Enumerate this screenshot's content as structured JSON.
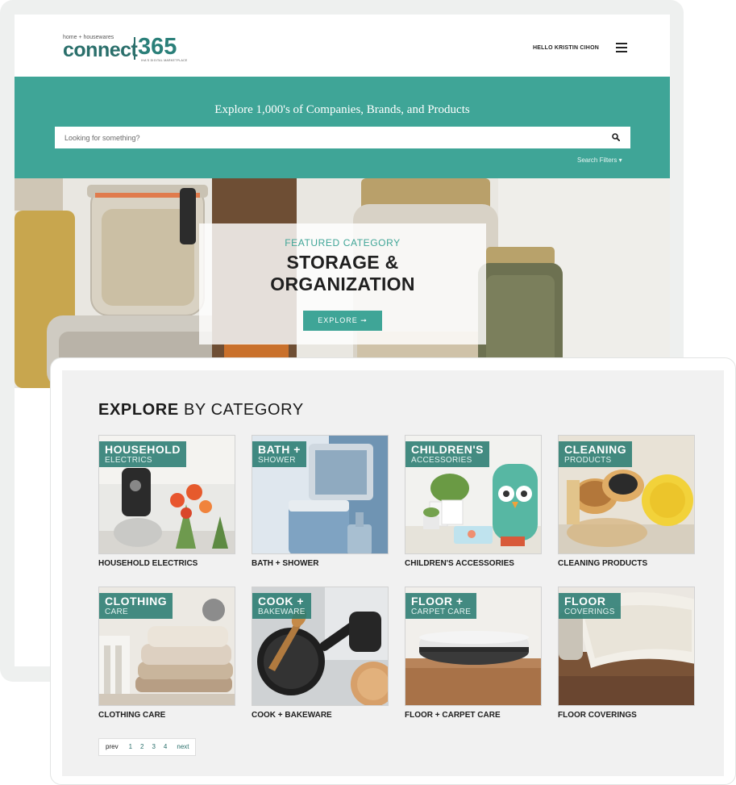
{
  "brand": {
    "logo_top": "home + housewares",
    "logo_word": "connect",
    "logo_number": "365",
    "logo_tagline": "IHA'S DIGITAL MARKETPLACE"
  },
  "header": {
    "greeting": "HELLO KRISTIN CIHON",
    "menu_icon": "hamburger-menu-icon"
  },
  "search": {
    "headline": "Explore 1,000's of Companies, Brands, and Products",
    "placeholder": "Looking for something?",
    "filters_label": "Search Filters ▾",
    "icon": "search-icon"
  },
  "hero": {
    "kicker": "FEATURED CATEGORY",
    "title": "STORAGE & ORGANIZATION",
    "button_label": "EXPLORE ➞"
  },
  "categories_section": {
    "title_bold": "EXPLORE",
    "title_rest": " BY CATEGORY",
    "items": [
      {
        "tag_main": "HOUSEHOLD",
        "tag_sub": "ELECTRICS",
        "label": "HOUSEHOLD ELECTRICS"
      },
      {
        "tag_main": "BATH +",
        "tag_sub": "SHOWER",
        "label": "BATH + SHOWER"
      },
      {
        "tag_main": "CHILDREN'S",
        "tag_sub": "ACCESSORIES",
        "label": "CHILDREN'S ACCESSORIES"
      },
      {
        "tag_main": "CLEANING",
        "tag_sub": "PRODUCTS",
        "label": "CLEANING PRODUCTS"
      },
      {
        "tag_main": "CLOTHING",
        "tag_sub": "CARE",
        "label": "CLOTHING CARE"
      },
      {
        "tag_main": "COOK +",
        "tag_sub": "BAKEWARE",
        "label": "COOK + BAKEWARE"
      },
      {
        "tag_main": "FLOOR +",
        "tag_sub": "CARPET CARE",
        "label": "FLOOR + CARPET CARE"
      },
      {
        "tag_main": "FLOOR",
        "tag_sub": "COVERINGS",
        "label": "FLOOR COVERINGS"
      }
    ]
  },
  "pagination": {
    "prev": "prev",
    "pages": [
      "1",
      "2",
      "3",
      "4"
    ],
    "next": "next"
  },
  "colors": {
    "teal": "#3fa597",
    "dark_teal": "#2a6f6b",
    "tag_bg": "#2a7c72"
  }
}
